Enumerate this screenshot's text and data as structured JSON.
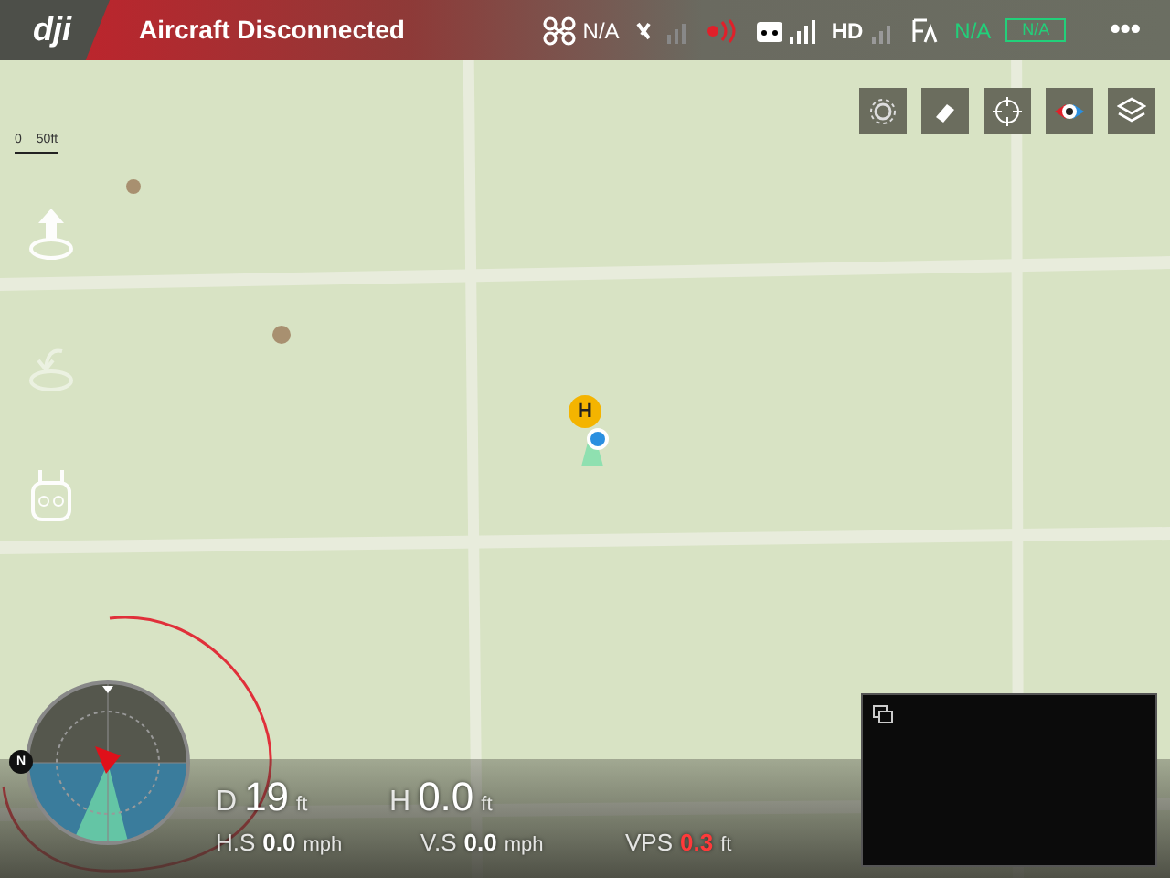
{
  "status_bar": {
    "logo": "dji",
    "title": "Aircraft Disconnected",
    "aircraft_status": "N/A",
    "hd_label": "HD",
    "gps_status": "N/A",
    "battery_status": "N/A",
    "menu": "•••"
  },
  "map_tools": [
    {
      "kind": "settings"
    },
    {
      "kind": "eraser"
    },
    {
      "kind": "locate"
    },
    {
      "kind": "direction"
    },
    {
      "kind": "layers"
    }
  ],
  "scale": {
    "zero": "0",
    "distance": "50ft"
  },
  "flight_buttons": [
    {
      "kind": "takeoff",
      "disabled": false
    },
    {
      "kind": "return-home",
      "disabled": true
    },
    {
      "kind": "remote",
      "disabled": false
    }
  ],
  "home_marker": "H",
  "compass": {
    "north": "N"
  },
  "telemetry": [
    {
      "label": "D",
      "value": "19",
      "unit": "ft",
      "kind": "large",
      "warning": false
    },
    {
      "label": "H",
      "value": "0.0",
      "unit": "ft",
      "kind": "large",
      "warning": false
    },
    {
      "label": "H.S",
      "value": "0.0",
      "unit": "mph",
      "kind": "small",
      "warning": false
    },
    {
      "label": "V.S",
      "value": "0.0",
      "unit": "mph",
      "kind": "small",
      "warning": false
    },
    {
      "label": "VPS",
      "value": "0.3",
      "unit": "ft",
      "kind": "small",
      "warning": true
    }
  ]
}
